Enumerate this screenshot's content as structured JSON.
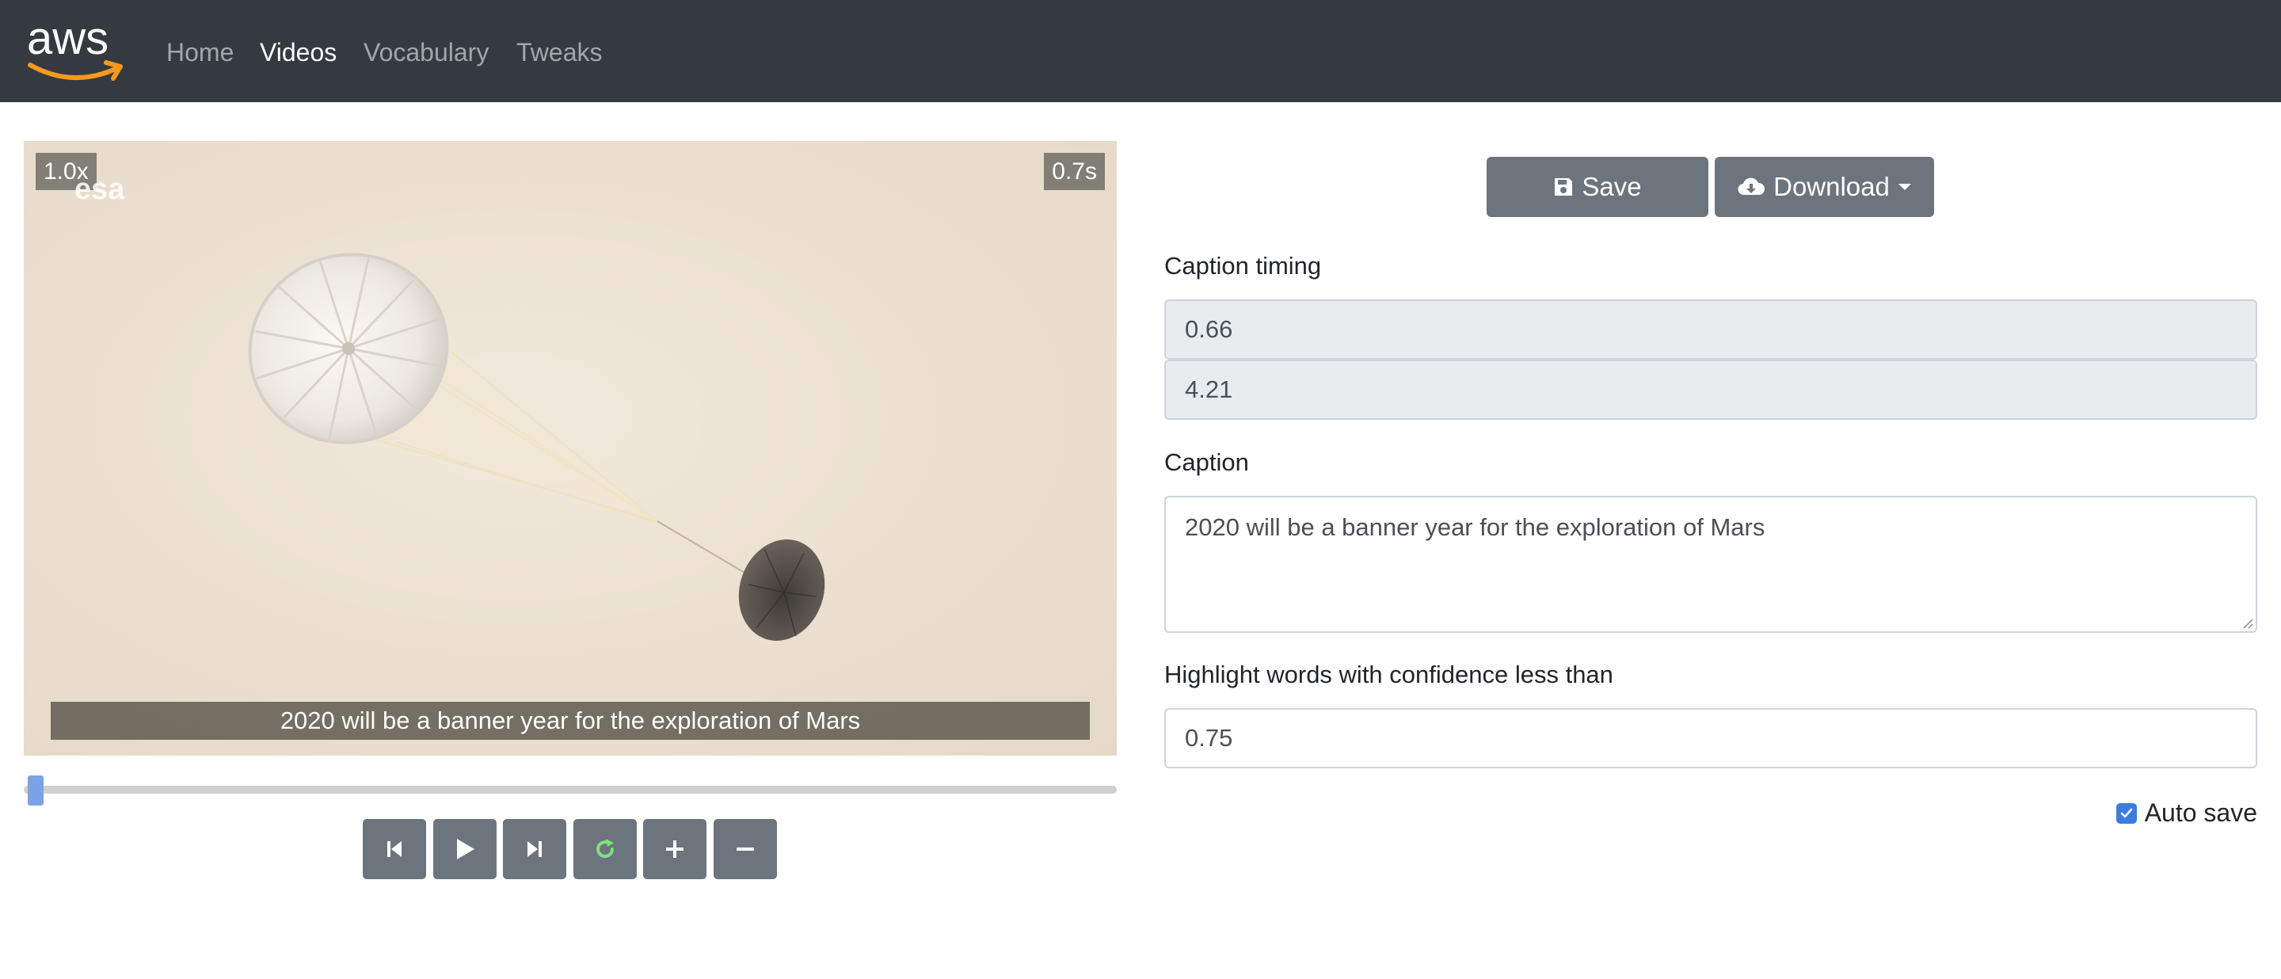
{
  "nav": {
    "brand": "aws",
    "links": [
      "Home",
      "Videos",
      "Vocabulary",
      "Tweaks"
    ],
    "active": "Videos"
  },
  "player": {
    "speed": "1.0x",
    "time": "0.7s",
    "watermark": "esa",
    "subtitle": "2020 will be a banner year for the exploration of Mars",
    "progress": 0.01
  },
  "controls": [
    "skip-back-icon",
    "play-icon",
    "skip-forward-icon",
    "replay-icon",
    "plus-icon",
    "minus-icon"
  ],
  "toolbar": {
    "save_label": "Save",
    "download_label": "Download"
  },
  "form": {
    "timing_label": "Caption timing",
    "start": "0.66",
    "end": "4.21",
    "caption_label": "Caption",
    "caption": "2020 will be a banner year for the exploration of Mars",
    "confidence_label": "Highlight words with confidence less than",
    "confidence": "0.75",
    "autosave_label": "Auto save",
    "autosave_checked": true
  },
  "colors": {
    "navbar": "#343a40",
    "button": "#6c757d",
    "accent": "#3b7ddd",
    "replay": "#7ee07e"
  }
}
